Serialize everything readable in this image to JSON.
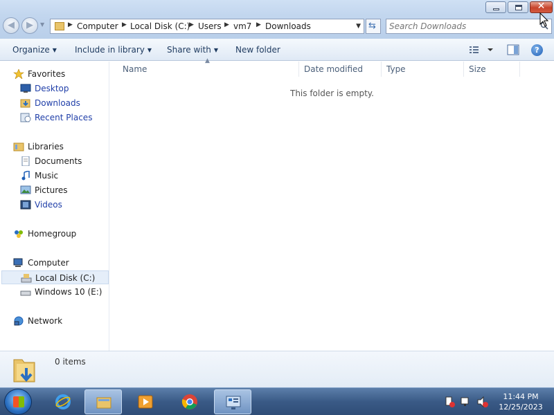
{
  "window": {
    "controls": {
      "minimize": "minimize",
      "maximize": "restore",
      "close": "✕"
    }
  },
  "address_bar": {
    "breadcrumbs": [
      "Computer",
      "Local Disk (C:)",
      "Users",
      "vm7",
      "Downloads"
    ]
  },
  "search": {
    "placeholder": "Search Downloads"
  },
  "command_bar": {
    "organize": "Organize",
    "include_in_library": "Include in library",
    "share_with": "Share with",
    "new_folder": "New folder"
  },
  "nav_pane": {
    "favorites": {
      "label": "Favorites",
      "items": [
        "Desktop",
        "Downloads",
        "Recent Places"
      ]
    },
    "libraries": {
      "label": "Libraries",
      "items": [
        "Documents",
        "Music",
        "Pictures",
        "Videos"
      ]
    },
    "homegroup": "Homegroup",
    "computer": {
      "label": "Computer",
      "items": [
        "Local Disk (C:)",
        "Windows 10 (E:)"
      ]
    },
    "network": "Network"
  },
  "file_list": {
    "columns": [
      "Name",
      "Date modified",
      "Type",
      "Size"
    ],
    "empty_message": "This folder is empty."
  },
  "details_pane": {
    "count": "0 items"
  },
  "taskbar": {
    "pinned": [
      "start-orb",
      "internet-explorer-icon",
      "windows-explorer-icon",
      "media-player-icon",
      "chrome-icon",
      "control-panel-icon"
    ],
    "clock": {
      "time": "11:44 PM",
      "date": "12/25/2023"
    }
  },
  "colors": {
    "accent": "#1f3ea8",
    "titlebar": "#c2d6ee",
    "taskbar": "#3a5a86"
  }
}
